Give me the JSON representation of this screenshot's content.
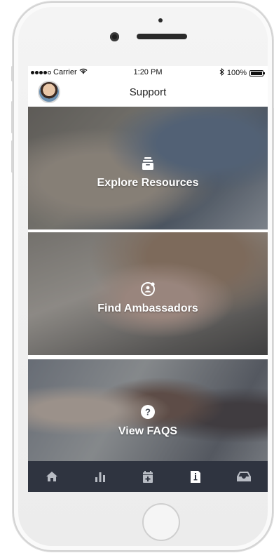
{
  "status_bar": {
    "carrier": "Carrier",
    "time": "1:20 PM",
    "battery": "100%"
  },
  "nav": {
    "title": "Support"
  },
  "cards": [
    {
      "label": "Explore Resources",
      "icon": "stack-box-icon"
    },
    {
      "label": "Find Ambassadors",
      "icon": "person-location-icon"
    },
    {
      "label": "View FAQS",
      "icon": "question-circle-icon"
    }
  ],
  "tab_bar": {
    "tabs": [
      {
        "name": "home",
        "icon": "home-icon"
      },
      {
        "name": "stats",
        "icon": "bar-chart-icon"
      },
      {
        "name": "calendar",
        "icon": "calendar-add-icon"
      },
      {
        "name": "info",
        "icon": "info-doc-icon",
        "active": true
      },
      {
        "name": "inbox",
        "icon": "inbox-icon"
      }
    ],
    "active_color": "#ffffff",
    "inactive_color": "#b8bcc4",
    "background": "#2f3440"
  }
}
